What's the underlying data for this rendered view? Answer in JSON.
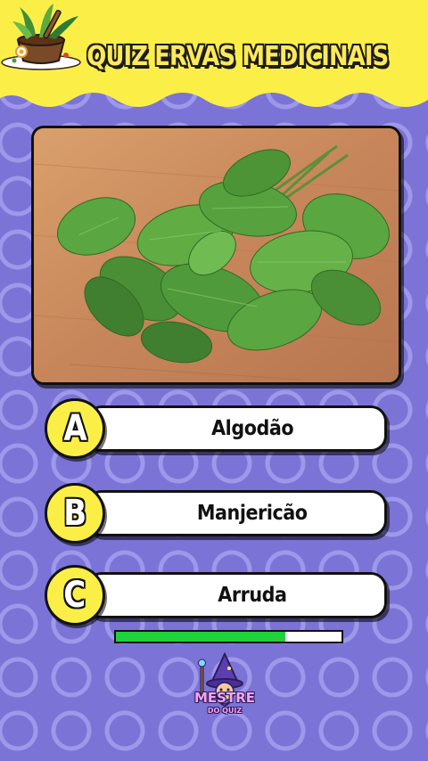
{
  "header": {
    "title": "QUIZ ERVAS MEDICINAIS",
    "background_color": "#fbef47",
    "logo_icon": "herbs-mortar-icon"
  },
  "question": {
    "image_icon": "basil-leaves-photo"
  },
  "options": [
    {
      "letter": "A",
      "text": "Algodão"
    },
    {
      "letter": "B",
      "text": "Manjericão"
    },
    {
      "letter": "C",
      "text": "Arruda"
    }
  ],
  "timer": {
    "progress": 0.75,
    "fill_color": "#21d13c"
  },
  "brand": {
    "name": "MESTRE",
    "subtitle": "DO QUIZ",
    "mascot_icon": "wizard-icon"
  },
  "background": {
    "color": "#7b73d6",
    "ring_color": "#aaa5f0"
  }
}
